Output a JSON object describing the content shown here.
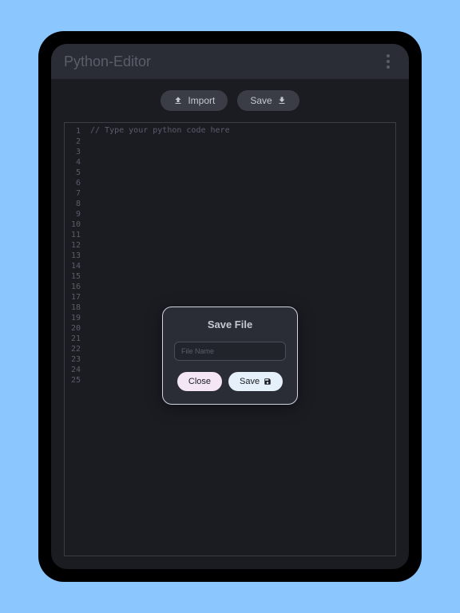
{
  "header": {
    "title": "Python-Editor"
  },
  "toolbar": {
    "import_label": "Import",
    "save_label": "Save"
  },
  "editor": {
    "placeholder": "// Type your python code here",
    "line_numbers": [
      1,
      2,
      3,
      4,
      5,
      6,
      7,
      8,
      9,
      10,
      11,
      12,
      13,
      14,
      15,
      16,
      17,
      18,
      19,
      20,
      21,
      22,
      23,
      24,
      25
    ]
  },
  "modal": {
    "title": "Save File",
    "input_placeholder": "File Name",
    "close_label": "Close",
    "save_label": "Save"
  }
}
